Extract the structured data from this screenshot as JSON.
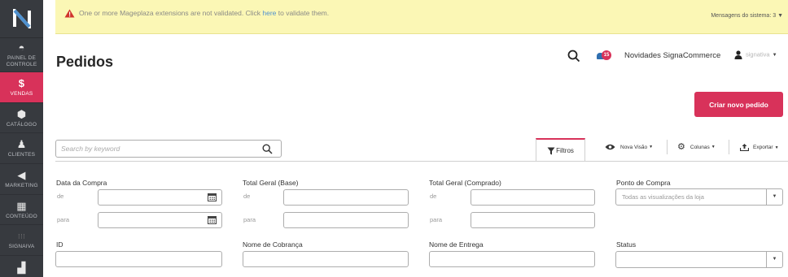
{
  "sidebar": {
    "items": [
      {
        "label": "PAINEL DE CONTROLE",
        "icon": "dashboard-icon"
      },
      {
        "label": "VENDAS",
        "icon": "dollar-icon",
        "active": true
      },
      {
        "label": "CATÁLOGO",
        "icon": "box-icon"
      },
      {
        "label": "CLIENTES",
        "icon": "person-icon"
      },
      {
        "label": "MARKETING",
        "icon": "megaphone-icon"
      },
      {
        "label": "CONTEÚDO",
        "icon": "layout-icon"
      },
      {
        "label": "SIGNAIVA",
        "icon": "dots-icon"
      },
      {
        "label": "",
        "icon": "bar-chart-icon"
      }
    ]
  },
  "notice": {
    "text_before": "One or more Mageplaza extensions are not validated. Click ",
    "link": "here",
    "text_after": " to validate them.",
    "system_messages": "Mensagens do sistema: 3"
  },
  "header": {
    "title": "Pedidos",
    "notifications_count": "15",
    "novidades": "Novidades SignaCommerce",
    "user": "signativa"
  },
  "actions": {
    "create_order": "Criar novo pedido"
  },
  "toolbar": {
    "search_placeholder": "Search by keyword",
    "filters": "Filtros",
    "view": "Nova Visão",
    "columns": "Colunas",
    "export": "Exportar"
  },
  "filters": {
    "purchase_date": {
      "label": "Data da Compra",
      "from": "de",
      "to": "para"
    },
    "grand_total_base": {
      "label": "Total Geral (Base)",
      "from": "de",
      "to": "para"
    },
    "grand_total_purchased": {
      "label": "Total Geral (Comprado)",
      "from": "de",
      "to": "para"
    },
    "purchase_point": {
      "label": "Ponto de Compra",
      "value": "Todas as visualizações da loja"
    },
    "id": {
      "label": "ID"
    },
    "billing_name": {
      "label": "Nome de Cobrança"
    },
    "shipping_name": {
      "label": "Nome de Entrega"
    },
    "status": {
      "label": "Status",
      "value": ""
    }
  },
  "colors": {
    "sidebar_bg": "#373a3f",
    "accent": "#d8325a",
    "notice_bg": "#fbf7b5",
    "link": "#4f91cf"
  }
}
